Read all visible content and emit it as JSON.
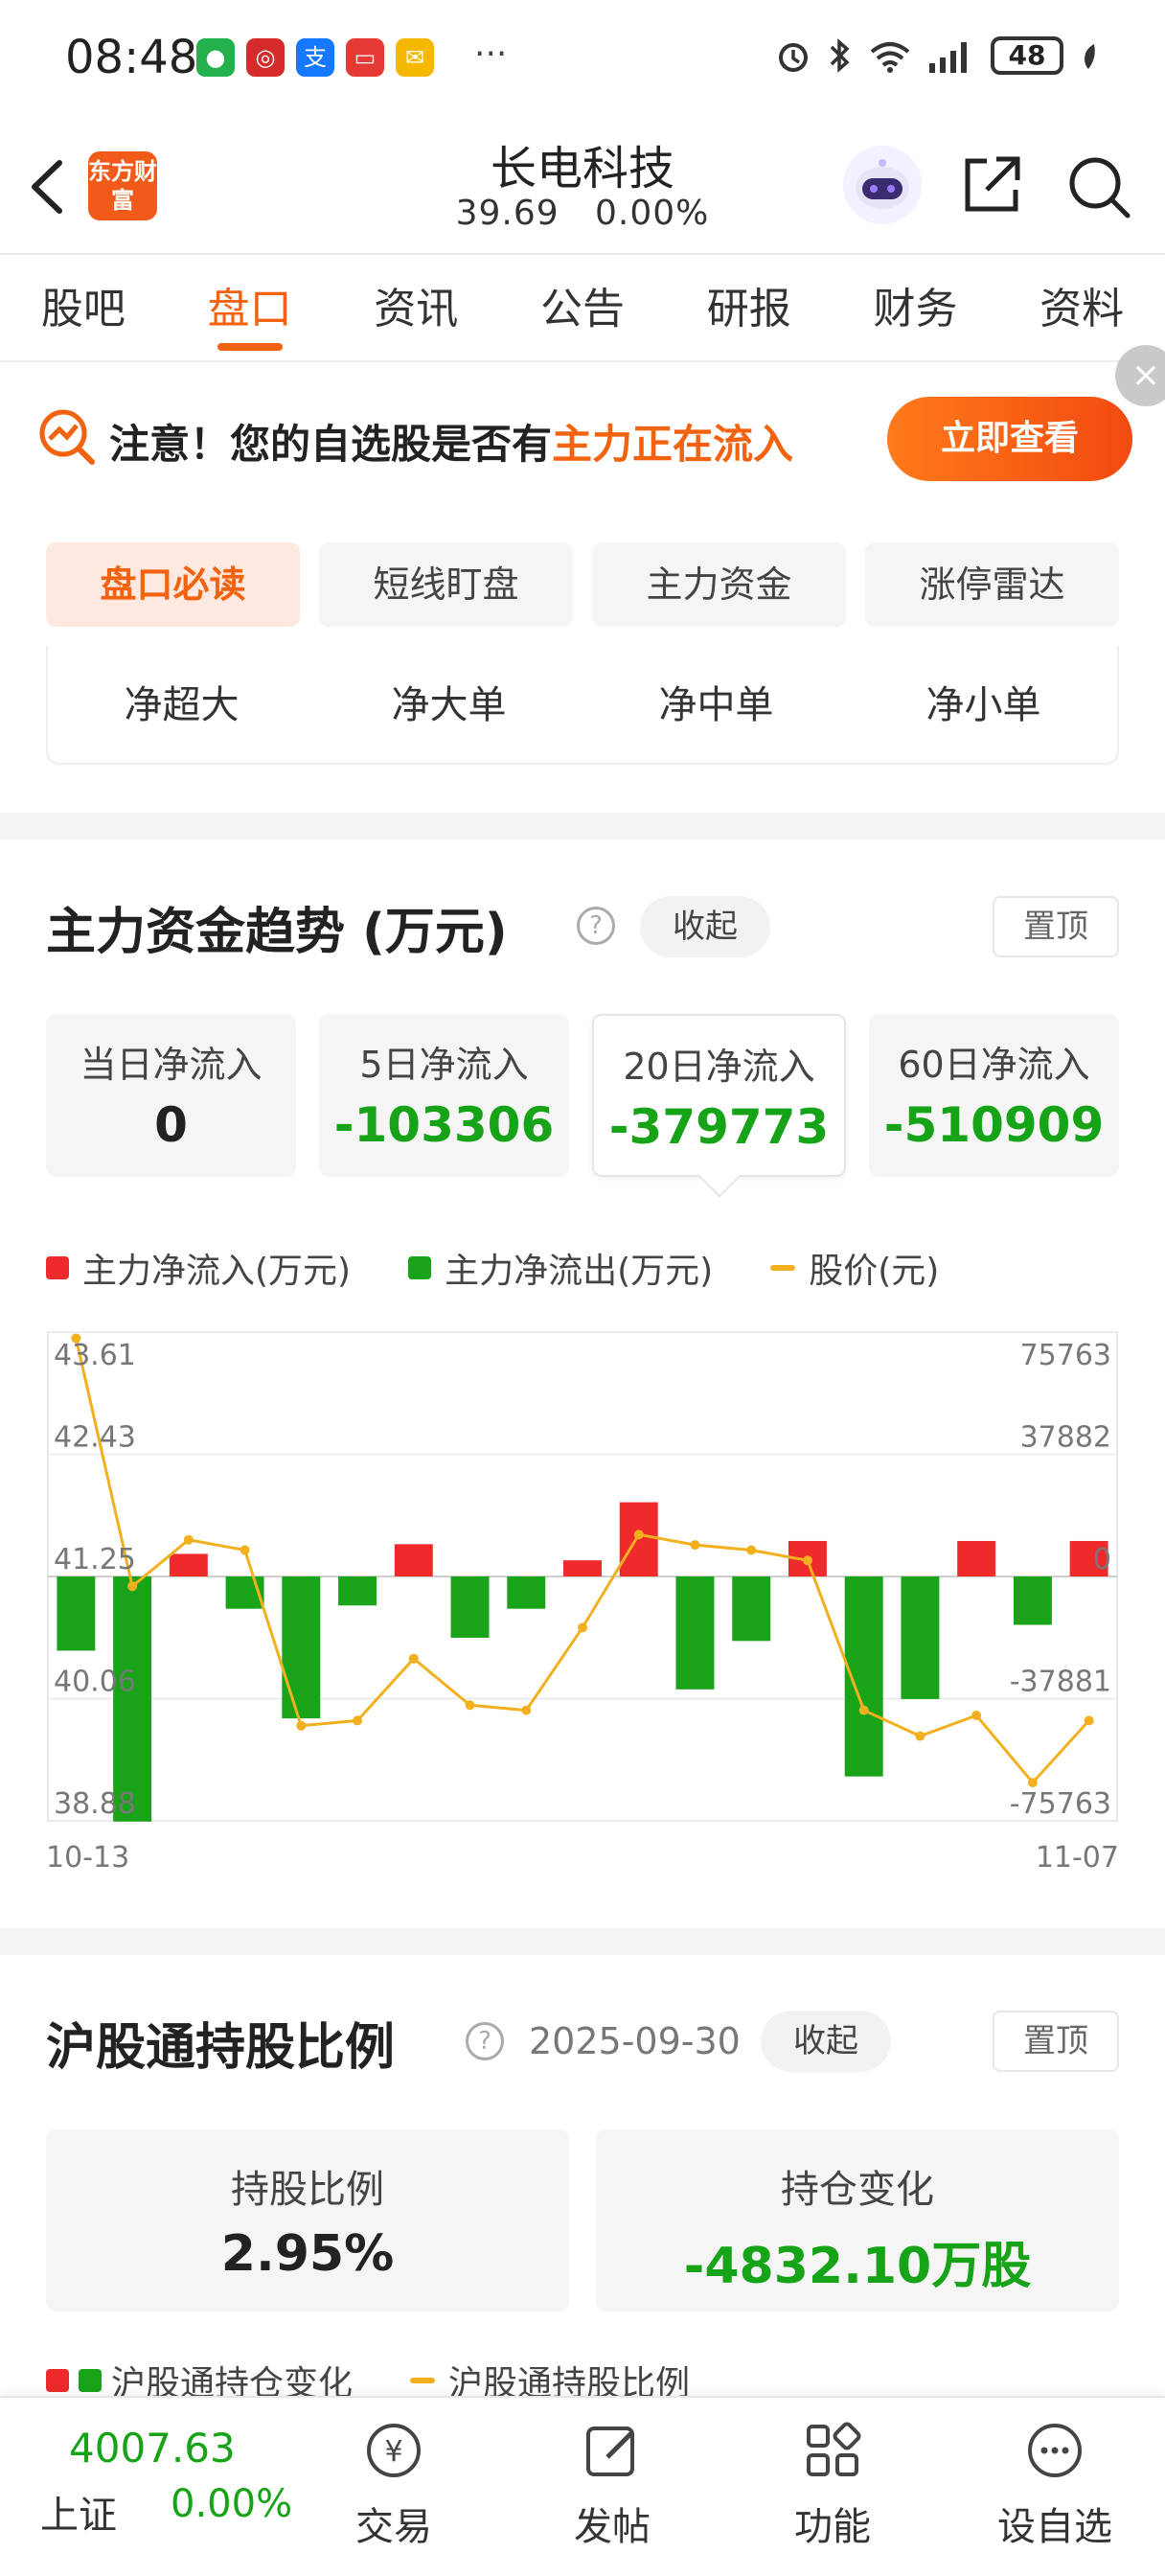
{
  "status_bar": {
    "time": "08:48",
    "more": "···",
    "battery": "48"
  },
  "header": {
    "logo_text": "东方财富",
    "stock_name": "长电科技",
    "price": "39.69",
    "change_pct": "0.00%"
  },
  "tabs": [
    "股吧",
    "盘口",
    "资讯",
    "公告",
    "研报",
    "财务",
    "资料"
  ],
  "active_tab": "盘口",
  "promo": {
    "prefix": "注意！您的自选股是否有",
    "highlight": "主力正在流入",
    "button": "立即查看",
    "close": "×"
  },
  "sub_tabs": [
    "盘口必读",
    "短线盯盘",
    "主力资金",
    "涨停雷达"
  ],
  "flow_tabs": [
    "净超大",
    "净大单",
    "净中单",
    "净小单"
  ],
  "fund_trend": {
    "title": "主力资金趋势 (万元)",
    "help": "?",
    "collapse": "收起",
    "pin": "置顶",
    "stats": [
      {
        "label": "当日净流入",
        "value": "0"
      },
      {
        "label": "5日净流入",
        "value": "-103306"
      },
      {
        "label": "20日净流入",
        "value": "-379773"
      },
      {
        "label": "60日净流入",
        "value": "-510909"
      }
    ],
    "legend": [
      "主力净流入(万元)",
      "主力净流出(万元)",
      "股价(元)"
    ]
  },
  "chart_data": {
    "type": "bar",
    "x_start_label": "10-13",
    "x_end_label": "11-07",
    "left_ticks": [
      "43.61",
      "42.43",
      "41.25",
      "40.06",
      "38.88"
    ],
    "right_ticks": [
      "75763",
      "37882",
      "0",
      "-37881",
      "-75763"
    ],
    "price_ylim": [
      38.88,
      43.61
    ],
    "flow_ylim": [
      -75763,
      75763
    ],
    "flows": [
      -23000,
      -76000,
      7000,
      -10000,
      -44000,
      -9000,
      10000,
      -19000,
      -10000,
      5000,
      23000,
      -35000,
      -20000,
      11000,
      -62000,
      -38000,
      11000,
      -15000,
      11000
    ],
    "price": [
      43.55,
      41.15,
      41.6,
      41.5,
      39.8,
      39.85,
      40.45,
      40.0,
      39.95,
      40.75,
      41.65,
      41.55,
      41.5,
      41.4,
      39.95,
      39.7,
      39.9,
      39.25,
      39.85
    ],
    "colors": {
      "inflow": "#ee2a2a",
      "outflow": "#18a318",
      "price": "#f2b01e"
    },
    "grid": true
  },
  "hk_connect": {
    "title": "沪股通持股比例",
    "help": "?",
    "date": "2025-09-30",
    "collapse": "收起",
    "pin": "置顶",
    "stats": [
      {
        "label": "持股比例",
        "value": "2.95%"
      },
      {
        "label": "持仓变化",
        "value": "-4832.10万股"
      }
    ],
    "legend": [
      "沪股通持仓变化",
      "沪股通持股比例"
    ]
  },
  "bottom_bar": {
    "index_value": "4007.63",
    "index_name": "上证",
    "index_pct": "0.00%",
    "nav": [
      "交易",
      "发帖",
      "功能",
      "设自选"
    ]
  }
}
